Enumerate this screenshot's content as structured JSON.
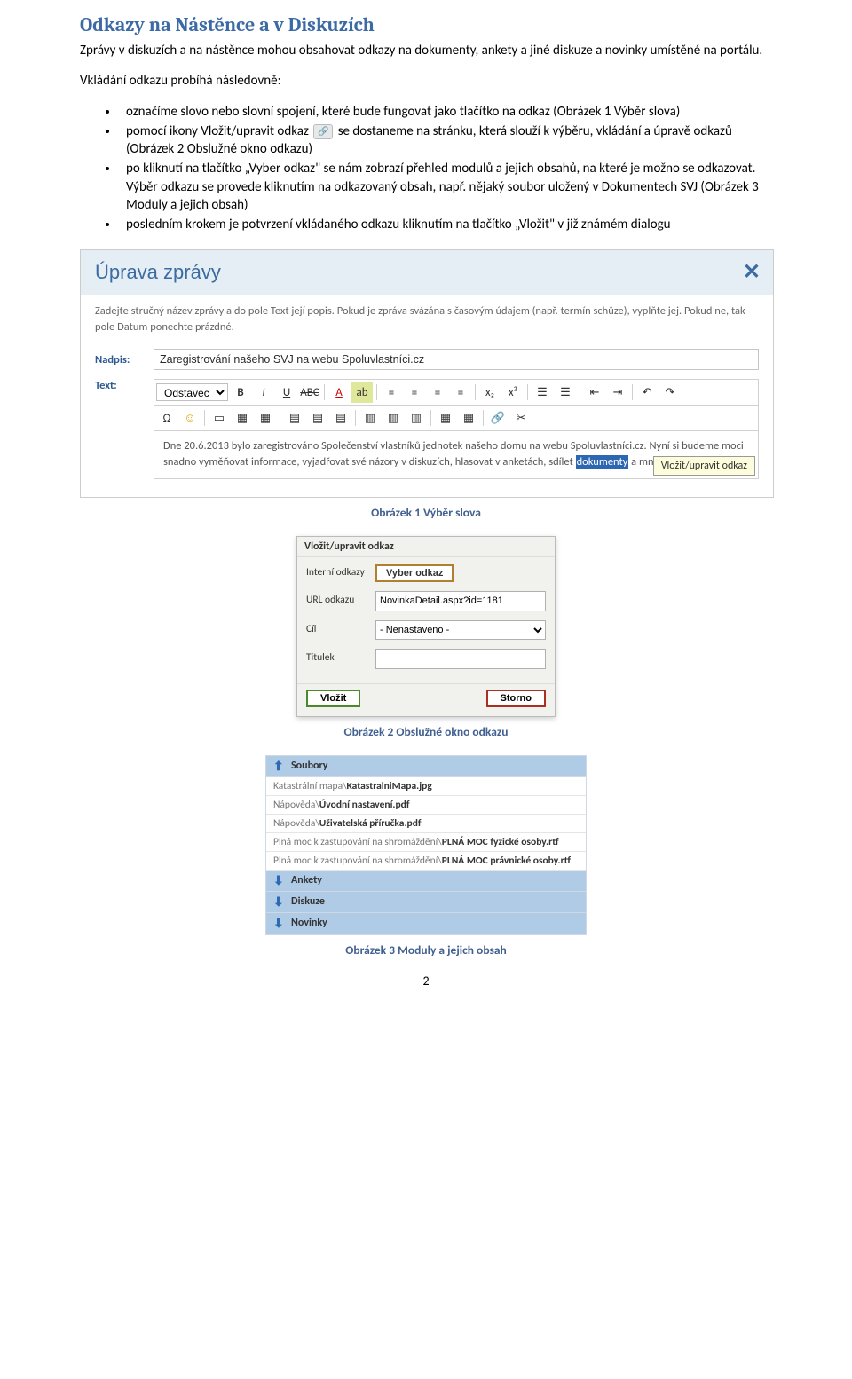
{
  "title": "Odkazy na Nástěnce a v Diskuzích",
  "intro": "Zprávy v diskuzích a na nástěnce mohou obsahovat odkazy na dokumenty, ankety a jiné diskuze a novinky umístěné na portálu.",
  "lead": "Vkládání odkazu probíhá následovně:",
  "bullets": {
    "b1a": "označíme slovo nebo slovní spojení, které bude fungovat jako tlačítko na odkaz (Obrázek 1 Výběr slova)",
    "b2a": "pomocí ikony Vložit/upravit odkaz ",
    "b2b": " se dostaneme na stránku, která slouží k výběru, vkládání a úpravě odkazů (Obrázek 2 Obslužné okno odkazu)",
    "b3": "po kliknutí na tlačítko „Vyber odkaz\" se nám zobrazí přehled modulů a jejich obsahů, na které je možno se odkazovat. Výběr odkazu se provede kliknutím na odkazovaný obsah, např. nějaký soubor uložený v Dokumentech SVJ (Obrázek 3 Moduly a jejich obsah)",
    "b4": "posledním krokem je potvrzení vkládaného odkazu kliknutím na tlačítko „Vložit\" v již známém dialogu"
  },
  "shot1": {
    "header": "Úprava zprávy",
    "desc": "Zadejte stručný název zprávy a do pole Text její popis. Pokud je zpráva svázána s časovým údajem (např. termín schůze), vyplňte jej. Pokud ne, tak pole Datum ponechte prázdné.",
    "nadpis_lbl": "Nadpis:",
    "nadpis_val": "Zaregistrování našeho SVJ na webu Spoluvlastníci.cz",
    "text_lbl": "Text:",
    "block_sel": "Odstavec",
    "tooltip": "Vložit/upravit odkaz",
    "content_a": "Dne 20.6.2013 bylo zaregistrováno Společenství vlastníků jednotek našeho domu na webu Spoluvlastníci.cz. Nyní si budeme moci snadno vyměňovat informace, vyjadřovat své názory v diskuzích, hlasovat v anketách, sdílet ",
    "content_hl": "dokumenty",
    "content_b": " a mnoho dalšího."
  },
  "caption1": "Obrázek 1 Výběr slova",
  "shot2": {
    "title": "Vložit/upravit odkaz",
    "r1_lbl": "Interní odkazy",
    "r1_btn": "Vyber odkaz",
    "r2_lbl": "URL odkazu",
    "r2_val": "NovinkaDetail.aspx?id=1181",
    "r3_lbl": "Cíl",
    "r3_val": "- Nenastaveno -",
    "r4_lbl": "Titulek",
    "r4_val": "",
    "primary": "Vložit",
    "cancel": "Storno"
  },
  "caption2": "Obrázek 2 Obslužné okno odkazu",
  "shot3": {
    "h1": "Soubory",
    "rows": [
      {
        "dim": "Katastrální mapa\\",
        "bold": "KatastralniMapa.jpg"
      },
      {
        "dim": "Nápověda\\",
        "bold": "Úvodní nastavení.pdf"
      },
      {
        "dim": "Nápověda\\",
        "bold": "Uživatelská příručka.pdf"
      },
      {
        "dim": "Plná moc k zastupování na shromáždění\\",
        "bold": "PLNÁ MOC fyzické osoby.rtf"
      },
      {
        "dim": "Plná moc k zastupování na shromáždění\\",
        "bold": "PLNÁ MOC právnické osoby.rtf"
      }
    ],
    "h2": "Ankety",
    "h3": "Diskuze",
    "h4": "Novinky"
  },
  "caption3": "Obrázek 3 Moduly a jejich obsah",
  "pagenum": "2"
}
